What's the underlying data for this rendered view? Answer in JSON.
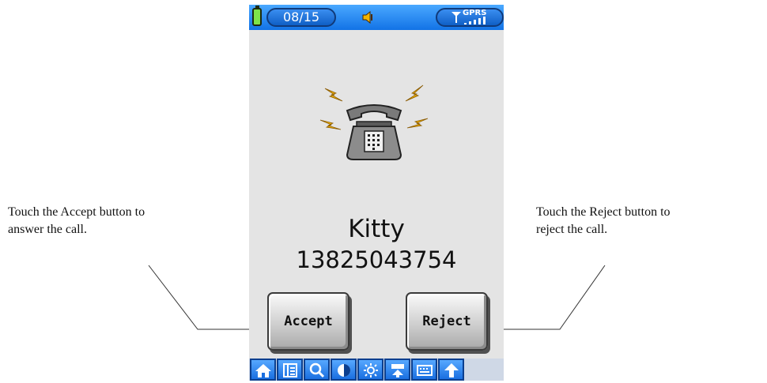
{
  "annotations": {
    "left": {
      "line1": "Touch the Accept button to",
      "line2": "answer the call."
    },
    "right": {
      "line1": "Touch the Reject button to",
      "line2": "reject the call."
    }
  },
  "status_bar": {
    "date": "08/15",
    "network": "GPRS",
    "icons": [
      "battery-icon",
      "speaker-icon",
      "antenna-icon",
      "signal-bars-icon"
    ]
  },
  "incoming_call": {
    "icon": "ringing-telephone-icon",
    "caller_name": "Kitty",
    "caller_number": "13825043754",
    "accept_label": "Accept",
    "reject_label": "Reject"
  },
  "toolbar": {
    "icons": [
      "home-icon",
      "contacts-book-icon",
      "search-icon",
      "contrast-icon",
      "brightness-icon",
      "menu-up-icon",
      "keyboard-icon",
      "arrow-up-icon"
    ]
  },
  "colors": {
    "status_bar": "#1f82f0",
    "screen_background": "#e4e4e4",
    "toolbar_button": "#2a7ff0",
    "lightning": "#f2b400"
  }
}
